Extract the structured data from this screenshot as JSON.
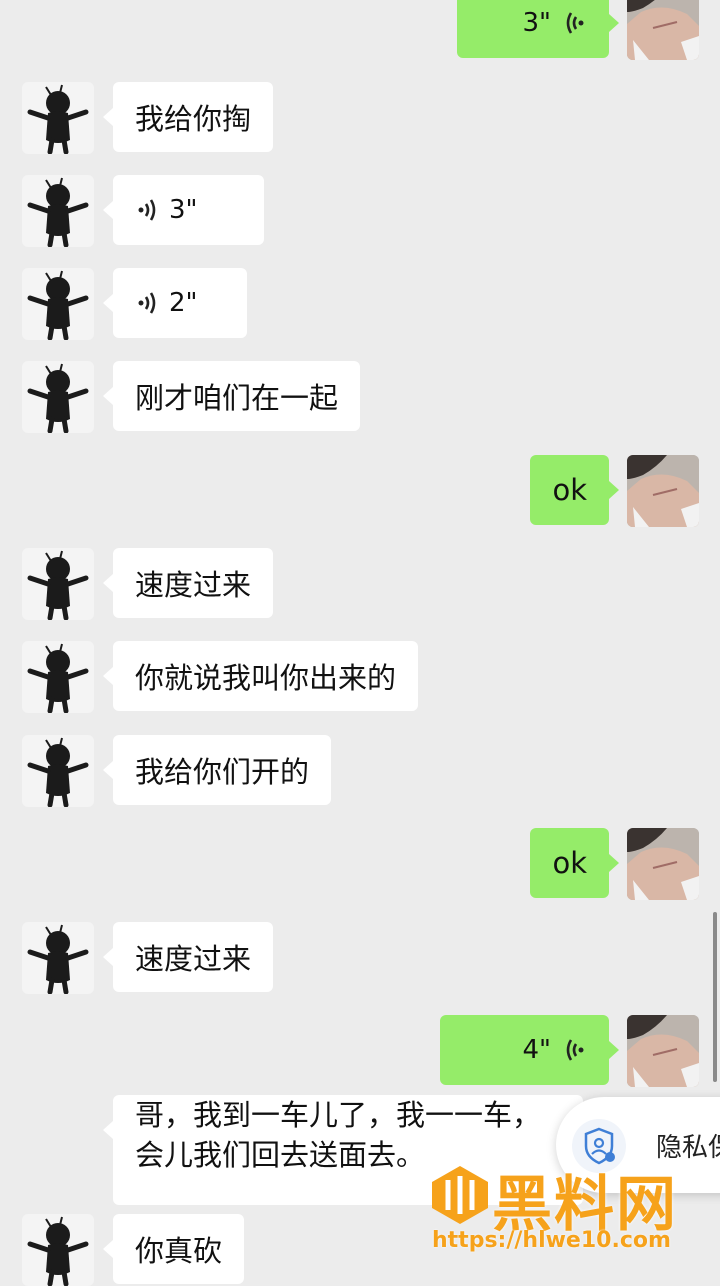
{
  "messages": [
    {
      "side": "right",
      "type": "voice",
      "duration": "3\""
    },
    {
      "side": "left",
      "type": "text",
      "text": "我给你掏"
    },
    {
      "side": "left",
      "type": "voice",
      "duration": "3\""
    },
    {
      "side": "left",
      "type": "voice",
      "duration": "2\""
    },
    {
      "side": "left",
      "type": "text",
      "text": "刚才咱们在一起"
    },
    {
      "side": "right",
      "type": "text",
      "text": "ok"
    },
    {
      "side": "left",
      "type": "text",
      "text": "速度过来"
    },
    {
      "side": "left",
      "type": "text",
      "text": "你就说我叫你出来的"
    },
    {
      "side": "left",
      "type": "text",
      "text": "我给你们开的"
    },
    {
      "side": "right",
      "type": "text",
      "text": "ok"
    },
    {
      "side": "left",
      "type": "text",
      "text": "速度过来"
    },
    {
      "side": "right",
      "type": "voice",
      "duration": "4\""
    },
    {
      "side": "left",
      "type": "text",
      "lines": [
        "哥，我到一车儿了，我一一车，",
        "会儿我们回去送面去。"
      ]
    },
    {
      "side": "left",
      "type": "text",
      "text": "你真砍"
    }
  ],
  "privacy": {
    "label": "隐私保"
  },
  "watermark": {
    "name": "黑料网",
    "url": "https://hlwe10.com"
  },
  "colors": {
    "background": "#ececec",
    "sent_bubble": "#95ec69",
    "received_bubble": "#ffffff",
    "watermark": "#f6a21b"
  }
}
